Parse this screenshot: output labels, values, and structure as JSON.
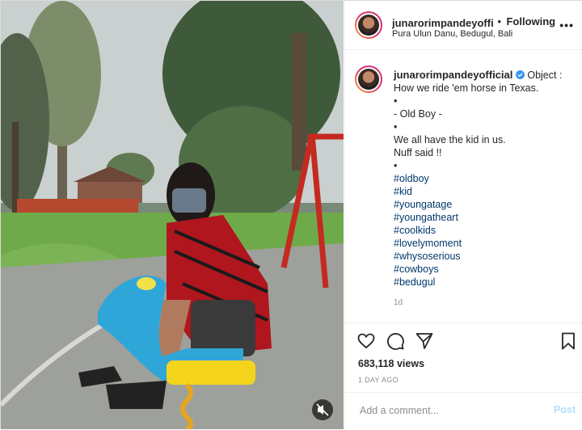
{
  "header": {
    "username": "junarorimpandeyofficial",
    "separator": "•",
    "follow_status": "Following",
    "location": "Pura Ulun Danu, Bedugul, Bali",
    "more_icon": "ellipsis-icon"
  },
  "caption": {
    "username": "junarorimpandeyofficial",
    "verified_icon": "verified-badge-icon",
    "lines": [
      "Object :",
      "How we ride 'em horse in Texas.",
      "•",
      "- Old Boy -",
      "•",
      "We all have the kid in us.",
      "Nuff said !!",
      "•"
    ],
    "hashtags": [
      "#oldboy",
      "#kid",
      "#youngatage",
      "#youngatheart",
      "#coolkids",
      "#lovelymoment",
      "#whysoserious",
      "#cowboys",
      "#bedugul"
    ],
    "age": "1d"
  },
  "actions": {
    "like_icon": "heart-icon",
    "comment_icon": "comment-icon",
    "share_icon": "send-icon",
    "save_icon": "bookmark-icon"
  },
  "stats": {
    "views": "683,118 views",
    "date": "1 DAY AGO"
  },
  "comment": {
    "placeholder": "Add a comment...",
    "post_label": "Post"
  },
  "media": {
    "mute_icon": "speaker-muted-icon"
  },
  "colors": {
    "link": "#00376b",
    "verified": "#3897f0",
    "post_disabled": "#b2dffc"
  }
}
